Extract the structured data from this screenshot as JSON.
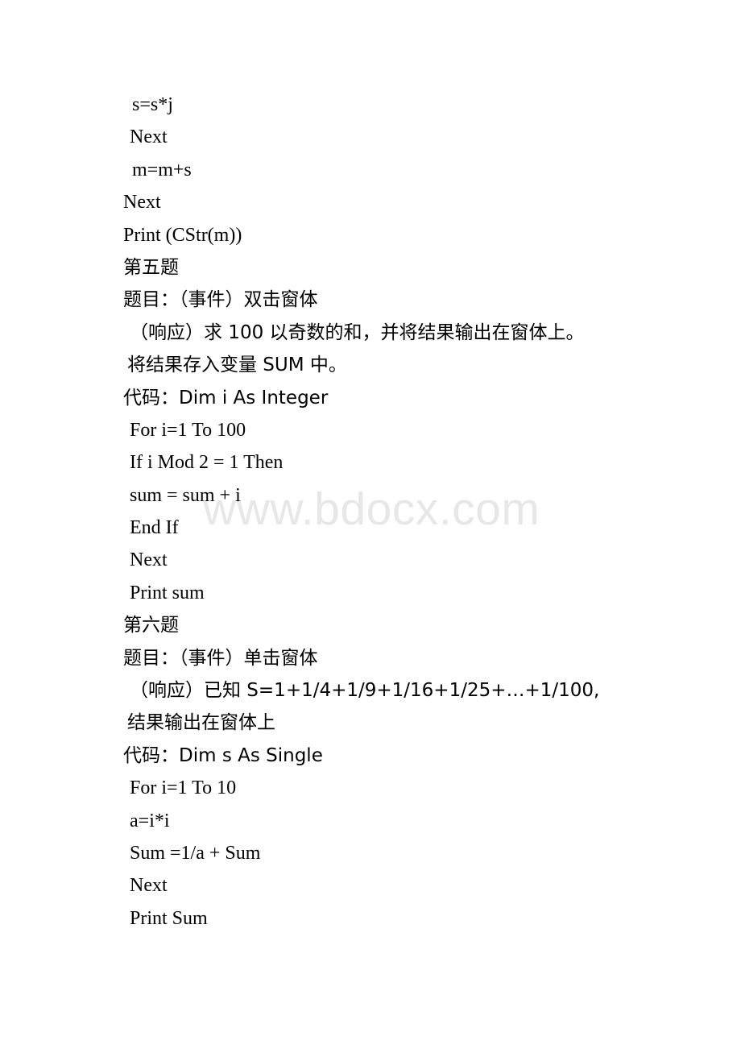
{
  "page": {
    "background_color": "#ffffff",
    "text_color": "#000000"
  },
  "watermark": {
    "text": "www.bdocx.com",
    "color": "#e7e7e7"
  },
  "lines": [
    {
      "text": "s=s*j",
      "indent": 3,
      "cjk": false
    },
    {
      "text": "Next",
      "indent": 2,
      "cjk": false
    },
    {
      "text": "m=m+s",
      "indent": 3,
      "cjk": false
    },
    {
      "text": "Next",
      "indent": 0,
      "cjk": false
    },
    {
      "text": "Print (CStr(m))",
      "indent": 0,
      "cjk": false
    },
    {
      "text": "第五题",
      "indent": 0,
      "cjk": true
    },
    {
      "text": "题目：（事件）双击窗体",
      "indent": 0,
      "cjk": true
    },
    {
      "text": "（响应）求 100 以奇数的和，并将结果输出在窗体上。",
      "indent": 2,
      "cjk": true
    },
    {
      "text": "将结果存入变量 SUM 中。",
      "indent": 1,
      "cjk": true
    },
    {
      "text": "代码：Dim i As Integer",
      "indent": 0,
      "cjk": true
    },
    {
      "text": "For i=1 To 100",
      "indent": 2,
      "cjk": false
    },
    {
      "text": "If i Mod 2 = 1 Then",
      "indent": 2,
      "cjk": false
    },
    {
      "text": "sum = sum + i",
      "indent": 2,
      "cjk": false
    },
    {
      "text": "End If",
      "indent": 2,
      "cjk": false
    },
    {
      "text": "Next",
      "indent": 2,
      "cjk": false
    },
    {
      "text": "Print sum",
      "indent": 2,
      "cjk": false
    },
    {
      "text": "第六题",
      "indent": 0,
      "cjk": true
    },
    {
      "text": "题目：（事件）单击窗体",
      "indent": 0,
      "cjk": true
    },
    {
      "text": "（响应）已知 S=1+1/4+1/9+1/16+1/25+…+1/100,",
      "indent": 2,
      "cjk": true
    },
    {
      "text": "结果输出在窗体上",
      "indent": 1,
      "cjk": true
    },
    {
      "text": "代码：Dim s As Single",
      "indent": 0,
      "cjk": true
    },
    {
      "text": "For i=1 To 10",
      "indent": 2,
      "cjk": false
    },
    {
      "text": "a=i*i",
      "indent": 2,
      "cjk": false
    },
    {
      "text": "Sum =1/a + Sum",
      "indent": 2,
      "cjk": false
    },
    {
      "text": "Next",
      "indent": 2,
      "cjk": false
    },
    {
      "text": "Print Sum",
      "indent": 2,
      "cjk": false
    }
  ]
}
